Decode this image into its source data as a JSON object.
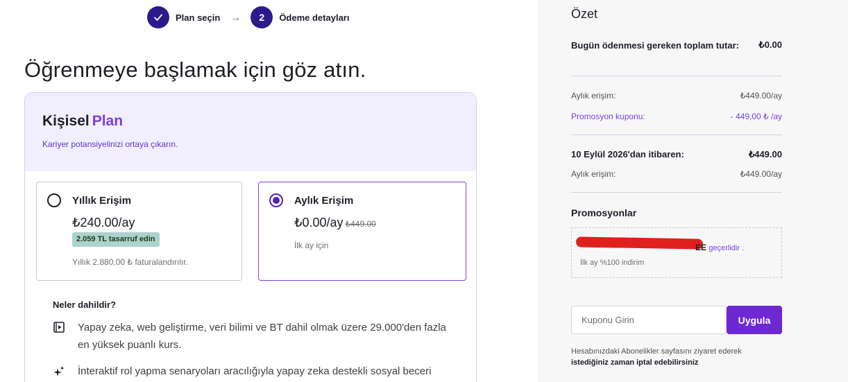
{
  "stepper": {
    "step1": {
      "label": "Plan seçin",
      "icon": "checkmark-icon"
    },
    "arrow": "→",
    "step2": {
      "number": "2",
      "label": "Ödeme detayları"
    }
  },
  "headline": "Öğrenmeye başlamak için göz atın.",
  "plan": {
    "title": "Kişisel",
    "title_accent": "Plan",
    "subtitle": "Kariyer potansiyelinizi ortaya çıkarın.",
    "options": {
      "yearly": {
        "title": "Yıllık Erişim",
        "price": "₺240.00/ay",
        "badge": "2.059 TL tasarruf edin",
        "note": "Yıllık 2.880,00 ₺ faturalandırılır.",
        "selected": false
      },
      "monthly": {
        "title": "Aylık Erişim",
        "price": "₺0.00/ay",
        "old_price": "₺449.00",
        "note": "İlk ay için",
        "selected": true
      }
    },
    "includes_title": "Neler dahildir?",
    "features": [
      {
        "icon": "video-play-icon",
        "text": "Yapay zeka, web geliştirme, veri bilimi ve BT dahil olmak üzere 29.000'den fazla en yüksek puanlı kurs."
      },
      {
        "icon": "sparkle-icon",
        "text": "İnteraktif rol yapma senaryoları aracılığıyla yapay zeka destekli sosyal beceri pratiği."
      }
    ]
  },
  "summary": {
    "heading": "Özet",
    "total_label": "Bugün ödenmesi gereken toplam tutar:",
    "total_value": "₺0.00",
    "monthly_access_label": "Aylık erişim:",
    "monthly_access_value": "₺449.00/ay",
    "promo_label": "Promosyon kuponu:",
    "promo_value": "- 449,00 ₺ /ay",
    "from_label": "10 Eylül 2026'dan itibaren:",
    "from_value": "₺449.00",
    "monthly_access_label2": "Aylık erişim:",
    "monthly_access_value2": "₺449.00/ay",
    "promotions_title": "Promosyonlar",
    "promo_code_visible": "EE",
    "promo_valid_text": "geçerlidir .",
    "promo_desc": "İlk ay %100 indirim",
    "coupon_placeholder": "Kuponu Girin",
    "apply_label": "Uygula",
    "cancel_text": "Hesabınızdaki Abonelikler sayfasını ziyaret ederek",
    "cancel_bold": "istediğiniz zaman iptal edebilirsiniz"
  },
  "colors": {
    "brand_dark": "#2d1a8a",
    "accent_purple": "#7e3ee0",
    "apply_button": "#6d28d2",
    "plan_header_bg": "#f1efff",
    "badge_bg": "#acd2cc",
    "summary_bg": "#f7f7f8"
  }
}
